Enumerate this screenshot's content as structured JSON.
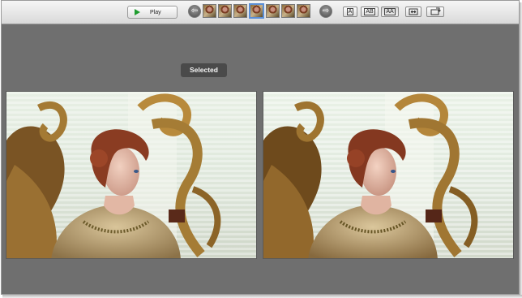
{
  "toolbar": {
    "play_label": "Play",
    "prev_icon": "left-arrow-icon",
    "next_icon": "right-arrow-icon",
    "thumbnails": [
      {
        "selected": false
      },
      {
        "selected": false
      },
      {
        "selected": false
      },
      {
        "selected": true
      },
      {
        "selected": false
      },
      {
        "selected": false
      },
      {
        "selected": false
      }
    ],
    "view_modes": [
      "A",
      "AB",
      "AA"
    ],
    "active_view_mode": "AA"
  },
  "compare": {
    "selected_badge": "Selected"
  },
  "colors": {
    "background": "#6f6f6f",
    "toolbar": "#e6e6e6",
    "selected_thumb_border": "#5b8fd6",
    "badge": "#4a4a4a",
    "play_icon": "#1e9c2e"
  }
}
